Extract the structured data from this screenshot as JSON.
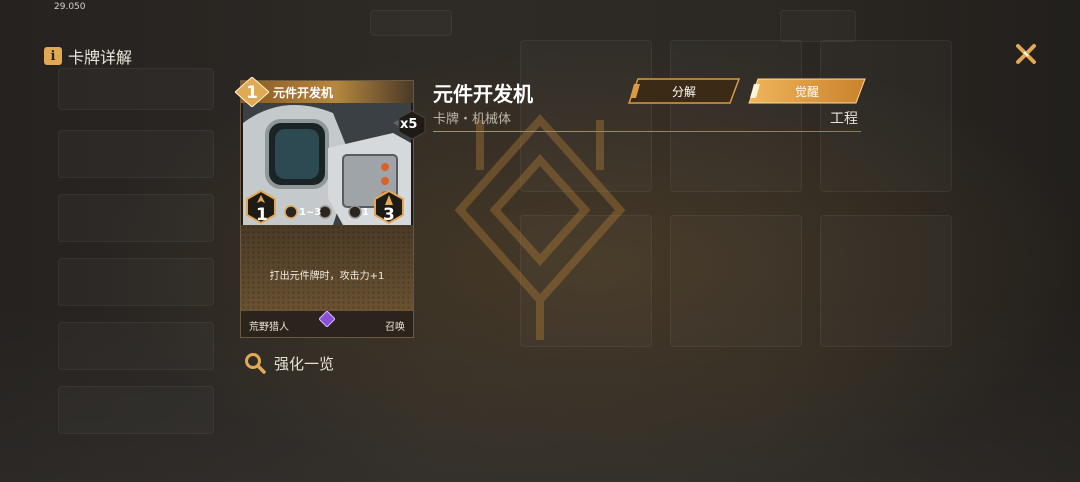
{
  "status_bar": {
    "time": "29.050"
  },
  "header": {
    "title": "卡牌详解",
    "info_icon": "info-icon",
    "close_icon": "close-icon"
  },
  "card": {
    "cost": "1",
    "name": "元件开发机",
    "copies": "x5",
    "left_stat": "1",
    "right_stat": "3",
    "range_text": "1~3",
    "small_stat": "1",
    "description": "打出元件牌时，攻击力+1",
    "faction": "荒野猎人",
    "type": "召唤"
  },
  "detail": {
    "name": "元件开发机",
    "subtitle": "卡牌・机械体",
    "category": "工程",
    "decompose_label": "分解",
    "awaken_label": "觉醒"
  },
  "enhance": {
    "label": "强化一览",
    "icon": "magnifier-icon"
  },
  "colors": {
    "accent": "#e2a955",
    "gold": "#c88a3a",
    "background": "#2b2723"
  }
}
